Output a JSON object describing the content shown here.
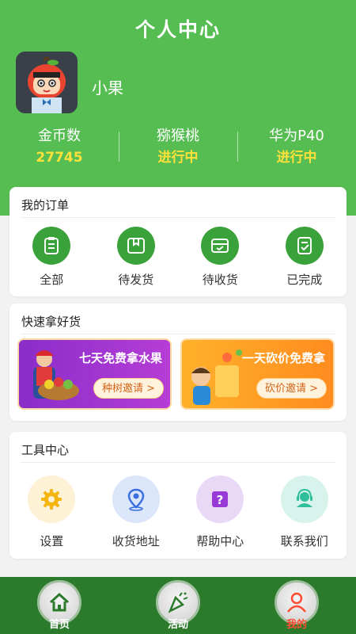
{
  "header": {
    "title": "个人中心",
    "username": "小果",
    "stats": [
      {
        "label": "金币数",
        "value": "27745"
      },
      {
        "label": "猕猴桃",
        "value": "进行中"
      },
      {
        "label": "华为P40",
        "value": "进行中"
      }
    ]
  },
  "orders": {
    "title": "我的订单",
    "items": [
      {
        "label": "全部",
        "icon": "clipboard-icon"
      },
      {
        "label": "待发货",
        "icon": "package-icon"
      },
      {
        "label": "待收货",
        "icon": "inbox-icon"
      },
      {
        "label": "已完成",
        "icon": "completed-doc-icon"
      }
    ]
  },
  "promo": {
    "title": "快速拿好货",
    "banners": [
      {
        "title": "七天免费拿水果",
        "button": "种树邀请 >"
      },
      {
        "title": "一天砍价免费拿",
        "button": "砍价邀请 >"
      }
    ]
  },
  "tools": {
    "title": "工具中心",
    "items": [
      {
        "label": "设置",
        "icon": "gear-icon"
      },
      {
        "label": "收货地址",
        "icon": "location-pin-icon"
      },
      {
        "label": "帮助中心",
        "icon": "help-icon"
      },
      {
        "label": "联系我们",
        "icon": "customer-service-icon"
      }
    ]
  },
  "tabbar": {
    "items": [
      {
        "label": "首页",
        "icon": "home-icon"
      },
      {
        "label": "活动",
        "icon": "party-popper-icon"
      },
      {
        "label": "我的",
        "icon": "user-icon"
      }
    ],
    "active_index": 2
  },
  "colors": {
    "header_green": "#56bd52",
    "accent_yellow": "#ffe13b",
    "tabbar_green": "#2c7a2c",
    "active_tab_red": "#ff4d33"
  }
}
